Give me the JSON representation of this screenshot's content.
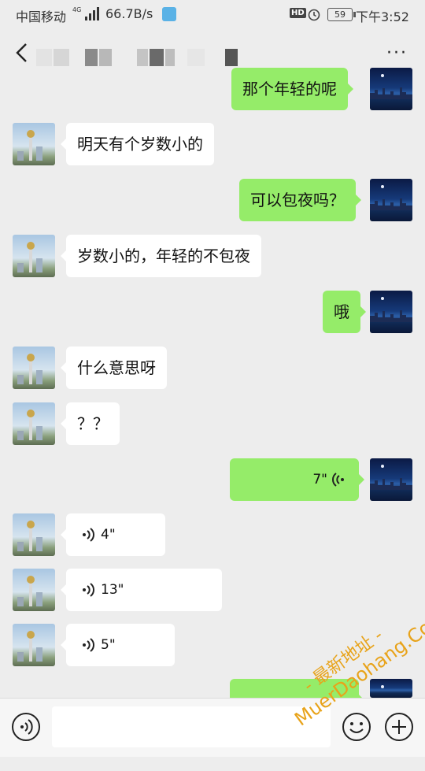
{
  "status_bar": {
    "carrier": "中国移动",
    "network": "4G",
    "speed": "66.7B/s",
    "hd": "HD",
    "battery": "59",
    "time": "下午3:52"
  },
  "header": {
    "back_icon": "chevron-left-icon",
    "more_label": "···"
  },
  "messages": [
    {
      "side": "out",
      "type": "text",
      "text": "那个年轻的呢"
    },
    {
      "side": "in",
      "type": "text",
      "text": "明天有个岁数小的"
    },
    {
      "side": "out",
      "type": "text",
      "text": "可以包夜吗？"
    },
    {
      "side": "in",
      "type": "text",
      "text": "岁数小的，年轻的不包夜"
    },
    {
      "side": "out",
      "type": "text",
      "text": "哦"
    },
    {
      "side": "in",
      "type": "text",
      "text": "什么意思呀"
    },
    {
      "side": "in",
      "type": "text",
      "text": "？？"
    },
    {
      "side": "out",
      "type": "voice",
      "duration": "7\""
    },
    {
      "side": "in",
      "type": "voice",
      "duration": "4\""
    },
    {
      "side": "in",
      "type": "voice",
      "duration": "13\""
    },
    {
      "side": "in",
      "type": "voice",
      "duration": "5\""
    }
  ],
  "input_bar": {
    "voice_icon": "voice-input-icon",
    "emoji_icon": "emoji-icon",
    "plus_icon": "plus-icon"
  },
  "watermark": {
    "line1": "- 最新地址 -",
    "line2": "MuerDaohang.Com"
  },
  "colors": {
    "outgoing_bubble": "#95ec69",
    "incoming_bubble": "#ffffff",
    "background": "#ededed",
    "watermark": "#e8a31a"
  }
}
